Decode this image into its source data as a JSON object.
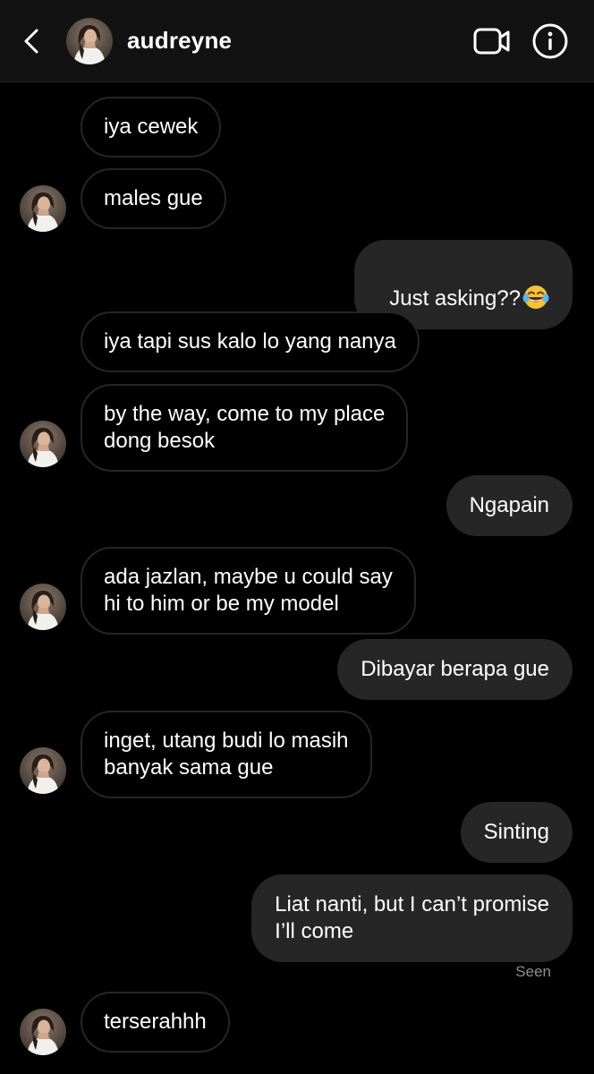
{
  "header": {
    "username": "audreyne",
    "icons": {
      "back": "chevron-left-icon",
      "video": "video-camera-icon",
      "info": "info-icon"
    }
  },
  "messages": [
    {
      "sender": "them",
      "text": "iya cewek"
    },
    {
      "sender": "them",
      "text": "males gue"
    },
    {
      "sender": "me",
      "text": "Just asking??",
      "emoji": "laughing-tears-emoji"
    },
    {
      "sender": "them",
      "text": "iya tapi sus kalo lo yang nanya"
    },
    {
      "sender": "them",
      "text": "by the way, come to my place\ndong besok"
    },
    {
      "sender": "me",
      "text": "Ngapain"
    },
    {
      "sender": "them",
      "text": "ada jazlan, maybe u could say\nhi to him or be my model"
    },
    {
      "sender": "me",
      "text": "Dibayar berapa gue"
    },
    {
      "sender": "them",
      "text": "inget, utang budi lo masih\nbanyak sama gue"
    },
    {
      "sender": "me",
      "text": "Sinting"
    },
    {
      "sender": "me",
      "text": "Liat nanti, but I can’t promise\nI’ll come"
    },
    {
      "sender": "them",
      "text": "terserahhh"
    }
  ],
  "status": {
    "seen": "Seen"
  },
  "colors": {
    "background": "#000000",
    "header": "#121212",
    "bubble_out": "#262626",
    "bubble_in_border": "#262626",
    "muted_text": "#8e8e8e"
  }
}
